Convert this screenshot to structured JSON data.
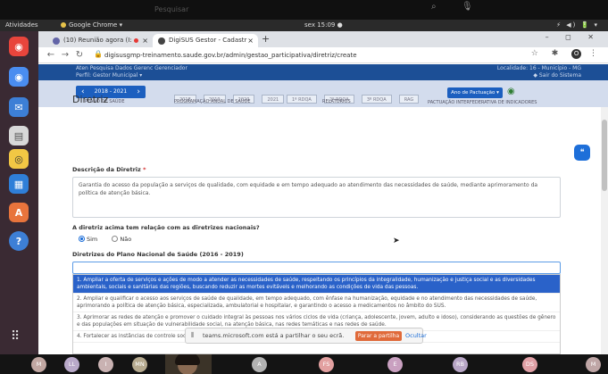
{
  "teams": {
    "search_placeholder": "Pesquisar",
    "icons": [
      "search-icon",
      "microphone-icon"
    ]
  },
  "ubuntu_bar": {
    "activities": "Atividades",
    "app_name": "Google Chrome ▾",
    "clock": "sex 15:09 ●",
    "system_icons": "⚡ ◀) 🔋 ▾"
  },
  "dock": {
    "items": [
      {
        "name": "chrome",
        "color": "#e8453c"
      },
      {
        "name": "chromium",
        "color": "#4a8df0"
      },
      {
        "name": "thunderbird",
        "color": "#3d7fd6"
      },
      {
        "name": "files",
        "color": "#e0e0e0"
      },
      {
        "name": "rhythmbox",
        "color": "#f2c744"
      },
      {
        "name": "writer",
        "color": "#2f7fd8"
      },
      {
        "name": "software",
        "color": "#e8743c"
      },
      {
        "name": "help",
        "color": "#3d7fd6"
      }
    ],
    "apps_grid_glyph": "⠿"
  },
  "browser": {
    "tabs": [
      {
        "title": "(10) Reunião agora (I:",
        "active": false
      },
      {
        "title": "DigiSUS Gestor - Cadastr",
        "active": true
      }
    ],
    "new_tab": "+",
    "window_controls": "– ◻ ✕",
    "url": "digisusgmp-treinamento.saude.gov.br/admin/gestao_participativa/diretriz/create",
    "toolbar_right": "☆ ✱",
    "profile": "O"
  },
  "app_header": {
    "user_line1": "Aten Pesquisa Dados Gerenc Gerenciador",
    "user_line2": "Perfil: Gestor Municipal ▾",
    "right_line1": "Localidade: 16 - Município - MG",
    "right_line2": "◆ Sair do Sistema",
    "year_nav": "2018 - 2021",
    "plano_label": "PLANO DE SAÚDE",
    "prog_years": [
      "2018",
      "2019",
      "2020",
      "2021"
    ],
    "prog_label": "PROGRAMAÇÃO ANUAL DE SAÚDE",
    "rel_chips": [
      "1º RDQA",
      "2º RDQA",
      "3º RDQA",
      "RAG"
    ],
    "rel_label": "RELATÓRIOS",
    "pact_button": "Ano de Pactuação ▾",
    "pact_label": "PACTUAÇÃO INTERFEDERATIVA DE INDICADORES"
  },
  "form": {
    "title": "Diretriz",
    "desc_label": "Descrição da Diretriz",
    "required_mark": "*",
    "desc_value": "Garantia do acesso da população a serviços de qualidade, com equidade e em tempo adequado ao atendimento das necessidades de saúde, mediante aprimoramento da política de atenção básica.",
    "question": "A diretriz acima tem relação com as diretrizes nacionais?",
    "radio_yes": "Sim",
    "radio_no": "Não",
    "selected": "Sim",
    "pns_label": "Diretrizes do Plano Nacional de Saúde (2016 - 2019)",
    "pns_options": [
      "1. Ampliar a oferta de serviços e ações de modo a atender as necessidades de saúde, respeitando os princípios da integralidade, humanização e justiça social e as diversidades ambientais, sociais e sanitárias das regiões, buscando reduzir as mortes evitáveis e melhorando as condições de vida das pessoas.",
      "2. Ampliar e qualificar o acesso aos serviços de saúde de qualidade, em tempo adequado, com ênfase na humanização, equidade e no atendimento das necessidades de saúde, aprimorando a política de atenção básica, especializada, ambulatorial e hospitalar, e garantindo o acesso a medicamentos no âmbito do SUS.",
      "3. Aprimorar as redes de atenção e promover o cuidado integral às pessoas nos vários ciclos de vida (criança, adolescente, jovem, adulto e idoso), considerando as questões de gênero e das populações em situação de vulnerabilidade social, na atenção básica, nas redes temáticas e nas redes de saúde.",
      "4. Fortalecer as instâncias de controle social e os canais de interação com o usuário, com garantia de"
    ]
  },
  "share_bar": {
    "text": "teams.microsoft.com está a partilhar o seu ecrã.",
    "stop": "Parar a partilha",
    "hide": "Ocultar"
  },
  "participants": [
    {
      "initials": "M",
      "color": "#c1a7a2"
    },
    {
      "initials": "LL",
      "color": "#b9a9c9"
    },
    {
      "initials": "I",
      "color": "#c9b2b2"
    },
    {
      "initials": "MN",
      "color": "#b6aa8f"
    },
    {
      "initials": "A",
      "color": "#b2b2b2"
    },
    {
      "initials": "FS",
      "color": "#e2a0a0"
    },
    {
      "initials": "E",
      "color": "#c9a0c0"
    },
    {
      "initials": "RB",
      "color": "#b8a6c6"
    },
    {
      "initials": "DS",
      "color": "#e0a0a6"
    },
    {
      "initials": "M",
      "color": "#bfa6a6"
    }
  ]
}
